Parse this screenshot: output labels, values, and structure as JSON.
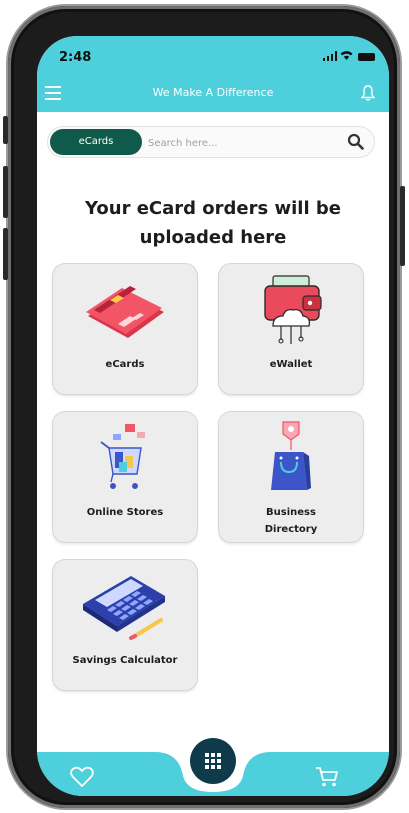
{
  "status": {
    "time": "2:48"
  },
  "header": {
    "title": "We Make A Difference"
  },
  "search": {
    "category": "eCards",
    "placeholder": "Search here..."
  },
  "main": {
    "headline_line1": "Your eCard orders will be",
    "headline_line2": "uploaded here",
    "tiles": [
      {
        "label": "eCards",
        "icon": "credit-card-icon"
      },
      {
        "label": "eWallet",
        "icon": "wallet-icon"
      },
      {
        "label": "Online Stores",
        "icon": "shopping-cart-icon"
      },
      {
        "label_line1": "Business",
        "label_line2": "Directory",
        "icon": "shopping-bag-icon"
      },
      {
        "label": "Savings Calculator",
        "icon": "calculator-icon"
      }
    ]
  },
  "bottom_nav": {
    "items": [
      "heart-icon",
      "grid-menu-icon",
      "cart-icon"
    ]
  },
  "colors": {
    "accent": "#4ecfdc",
    "pill": "#0f5a4a",
    "fab": "#0e3a4a",
    "tile": "#ededed"
  }
}
